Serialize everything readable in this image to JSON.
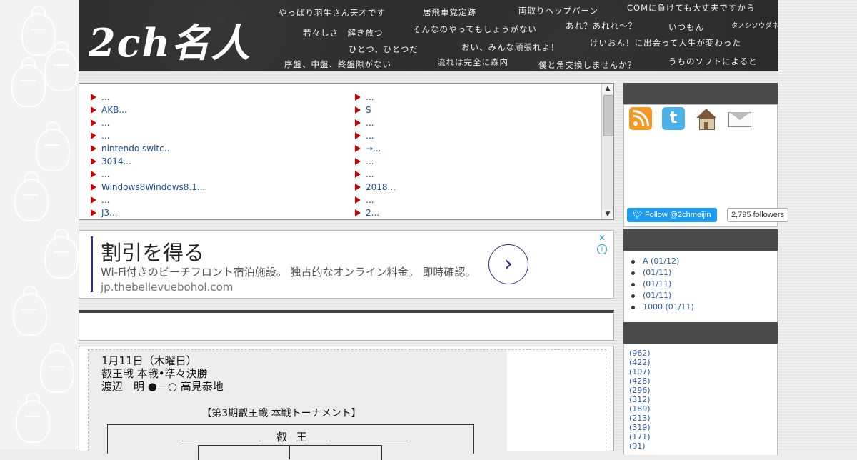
{
  "header": {
    "logo": "2ch名人",
    "phrases": [
      "やっぱり羽生さん天才です",
      "居飛車党定跡",
      "両取りヘップバーン",
      "COMに負けても大丈夫ですから",
      "若々しさ　解き放つ",
      "そんなのやってもしょうがない",
      "あれ？あれれ〜？",
      "いつもん",
      "タノシソウダネ",
      "ひとつ、ひとつだ",
      "おい、みんな頑張れよ！",
      "けいおん！に出会って人生が変わった",
      "序盤、中盤、終盤隙がない",
      "流れは完全に森内",
      "僕と角交換しませんか？",
      "うちのソフトによると"
    ]
  },
  "list": {
    "left": [
      " ...",
      "AKB...",
      " ...",
      "...",
      "nintendo switc...",
      "3014...",
      "...",
      "Windows8Windows8.1...",
      "...",
      "J3..."
    ],
    "right": [
      "...",
      "S",
      "...",
      "...",
      " →...",
      "...",
      "...",
      "2018...",
      "...",
      "2..."
    ]
  },
  "ad": {
    "headline": "割引を得る",
    "description": "Wi-Fi付きのビーチフロント宿泊施設。 独占的なオンライン料金。 即時確認。",
    "url": "jp.thebellevuebohol.com",
    "next_symbol": "›",
    "close_symbol": "✕",
    "info_symbol": "i"
  },
  "article": {
    "date": "1月11日（木曜日）",
    "event": "叡王戦 本戦•準々決勝",
    "result": "渡辺　明 ●－○ 高見泰地",
    "bracket_title": "【第3期叡王戦 本戦トーナメント】",
    "bracket_top": "叡 王"
  },
  "sidebar": {
    "twitter_glyph": "t",
    "follow_label": "Follow @2chmeijin",
    "followers": "2,795 followers",
    "recent": [
      "A (01/12)",
      " (01/11)",
      " (01/11)",
      " (01/11)",
      "1000 (01/11)"
    ],
    "counts": [
      "(962)",
      "(422)",
      "(107)",
      "(428)",
      "(296)",
      "(312)",
      "(189)",
      "(213)",
      "(319)",
      "(171)",
      "(91)"
    ]
  }
}
